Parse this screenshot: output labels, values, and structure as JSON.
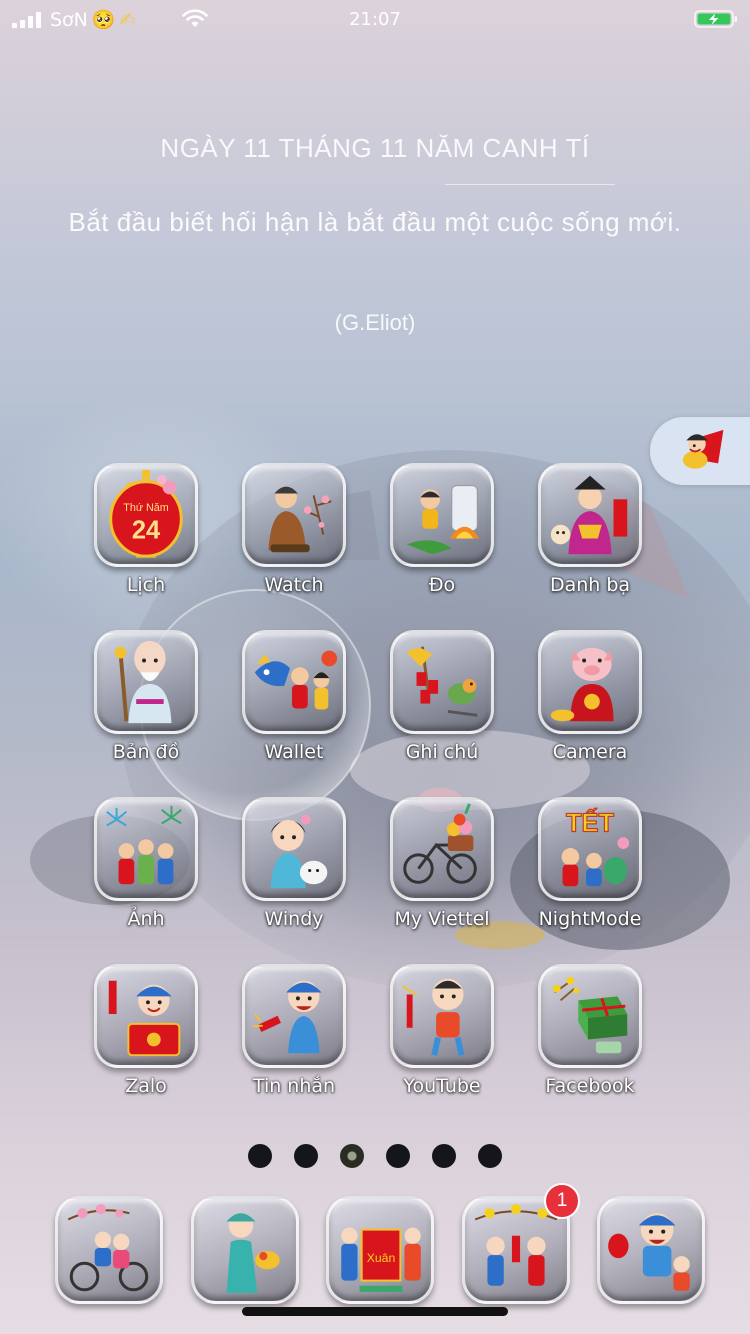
{
  "status_bar": {
    "carrier": "SơN",
    "carrier_emoji": "🥺",
    "carrier_extra": "✍",
    "time": "21:07"
  },
  "widget": {
    "date": "NGÀY 11 THÁNG 11 NĂM CANH TÍ",
    "quote": "Bắt đầu biết hối hận là bắt đầu một cuộc sống mới.",
    "author": "(G.Eliot)"
  },
  "calendar_tile": {
    "weekday": "Thứ Năm",
    "day": "24"
  },
  "apps": [
    {
      "label": "Lịch",
      "icon": "red-lantern-calendar-icon"
    },
    {
      "label": "Watch",
      "icon": "old-man-peach-blossom-icon"
    },
    {
      "label": "Đo",
      "icon": "boy-cooking-pot-icon"
    },
    {
      "label": "Danh bạ",
      "icon": "kitchen-god-icon"
    },
    {
      "label": "Bản đồ",
      "icon": "longevity-god-icon"
    },
    {
      "label": "Wallet",
      "icon": "lion-dance-kids-icon"
    },
    {
      "label": "Ghi chú",
      "icon": "firecracker-bird-icon"
    },
    {
      "label": "Camera",
      "icon": "pig-money-bag-icon"
    },
    {
      "label": "Ảnh",
      "icon": "family-fireworks-icon"
    },
    {
      "label": "Windy",
      "icon": "girl-with-puppy-icon"
    },
    {
      "label": "My Viettel",
      "icon": "flower-bicycle-icon"
    },
    {
      "label": "NightMode",
      "icon": "tet-banner-icon"
    },
    {
      "label": "Zalo",
      "icon": "boy-red-envelope-icon"
    },
    {
      "label": "Tin nhắn",
      "icon": "boy-firecracker-icon"
    },
    {
      "label": "YouTube",
      "icon": "kid-firecracker-icon"
    },
    {
      "label": "Facebook",
      "icon": "banh-chung-icon"
    }
  ],
  "dock": [
    {
      "icon": "couple-bicycle-icon"
    },
    {
      "icon": "girl-ao-dai-icon"
    },
    {
      "icon": "couple-red-card-icon",
      "card_text": "Xuân"
    },
    {
      "icon": "couple-apricot-icon",
      "badge": "1"
    },
    {
      "icon": "family-lantern-icon"
    }
  ],
  "page_dots": {
    "count": 6,
    "active": 3
  },
  "colors": {
    "lantern_red": "#d8141c",
    "gold": "#f3c02e",
    "badge_red": "#e8303a",
    "battery_green": "#34c759"
  }
}
